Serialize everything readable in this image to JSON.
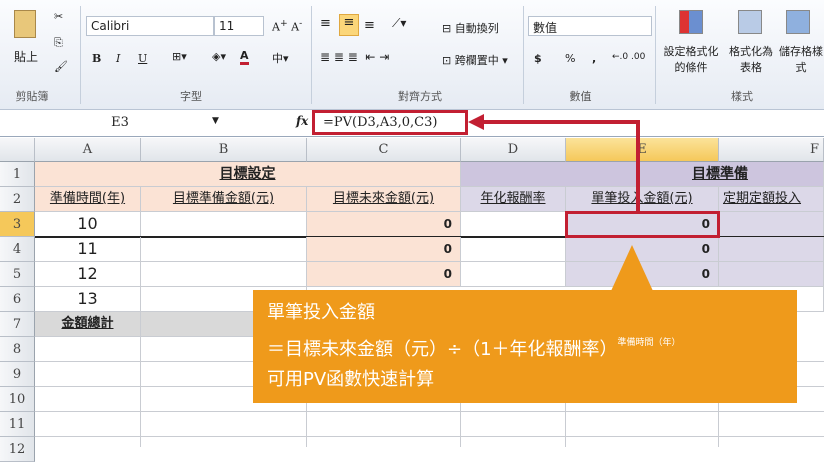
{
  "ribbon": {
    "clipboard": {
      "paste": "貼上",
      "label": "剪貼簿"
    },
    "font": {
      "name": "Calibri",
      "size": "11",
      "bold": "B",
      "italic": "I",
      "underline": "U",
      "label": "字型"
    },
    "alignment": {
      "wrap": "自動換列",
      "merge": "跨欄置中",
      "label": "對齊方式"
    },
    "number": {
      "format": "數值",
      "currency": "$",
      "percent": "%",
      "comma": ",",
      "label": "數值"
    },
    "styles": {
      "conditional": "設定格式化的條件",
      "table": "格式化為表格",
      "cell": "儲存格樣式",
      "label": "樣式"
    }
  },
  "formula_bar": {
    "name_box": "E3",
    "fx": "fx",
    "formula": "=PV(D3,A3,0,C3)"
  },
  "columns": [
    "A",
    "B",
    "C",
    "D",
    "E",
    "F"
  ],
  "rows": [
    "1",
    "2",
    "3",
    "4",
    "5",
    "6",
    "7",
    "8",
    "9",
    "10",
    "11",
    "12"
  ],
  "sheet": {
    "group1": "目標設定",
    "group2": "目標準備",
    "headers": [
      "準備時間(年)",
      "目標準備金額(元)",
      "目標未來金額(元)",
      "年化報酬率",
      "單筆投入金額(元)",
      "定期定額投入"
    ],
    "data": [
      {
        "a": "10",
        "c": "0",
        "e": "0"
      },
      {
        "a": "11",
        "c": "0",
        "e": "0"
      },
      {
        "a": "12",
        "c": "0",
        "e": "0"
      },
      {
        "a": "13"
      }
    ],
    "total_label": "金額總計"
  },
  "callout": {
    "line1": "單筆投入金額",
    "line2": "＝目標未來金額（元）÷（1＋年化報酬率）",
    "superscript": "準備時間（年）",
    "line3": "可用PV函數快速計算"
  },
  "colors": {
    "accent": "#c21f32",
    "callout": "#ef9a1b",
    "peach": "#fbe3d5",
    "lavender": "#dcd8e8"
  }
}
